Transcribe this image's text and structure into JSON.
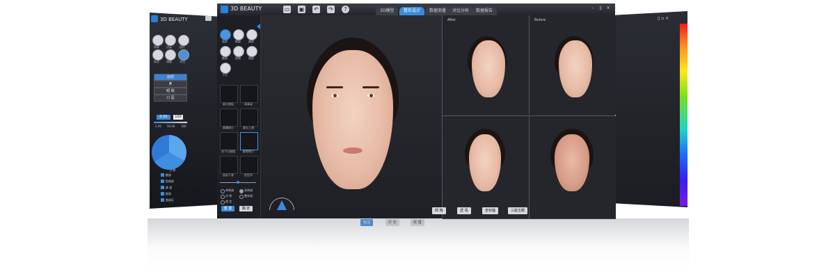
{
  "app": {
    "name": "3D BEAUTY"
  },
  "main": {
    "tabs": [
      {
        "label": "3D模型",
        "active": false
      },
      {
        "label": "整形设计",
        "active": true
      },
      {
        "label": "数据测量",
        "active": false
      },
      {
        "label": "对比分析",
        "active": false
      },
      {
        "label": "数据报告",
        "active": false
      }
    ],
    "window_controls": [
      "–",
      "▯",
      "×"
    ],
    "tool_labels": [
      "面部",
      "眼部",
      "鼻部",
      "额部",
      "脸颊",
      "唇部",
      "下巴"
    ],
    "thumbs": [
      "鼻头翘起",
      "高鼻梁",
      "鼻翼缩小",
      "鼻尖上翘",
      "双下巴抽脂",
      "颧骨缩小",
      "面部下垂",
      "脸型窄"
    ],
    "radio_options": [
      {
        "label": "单侧调",
        "on": false
      },
      {
        "label": "多侧调",
        "on": true
      },
      {
        "label": "对  称",
        "on": false
      },
      {
        "label": "整体调",
        "on": false
      },
      {
        "label": "锁  定",
        "on": false
      }
    ],
    "panel_buttons": [
      "重  置",
      "确  定"
    ],
    "split_labels": {
      "after": "After",
      "before": "Before"
    },
    "view_buttons": [
      {
        "label": "标注",
        "active": true
      },
      {
        "label": "灯 光",
        "active": false
      },
      {
        "label": "纹 理",
        "active": false
      },
      {
        "label": "网 格",
        "active": false
      },
      {
        "label": "透 视",
        "active": false
      },
      {
        "label": "坐标轴",
        "active": false
      },
      {
        "label": "三庭五眼",
        "active": false
      }
    ]
  },
  "left_window": {
    "title": "3D BEAUTY",
    "tool_labels": [
      "线条",
      "点云",
      "面片",
      "标注",
      "测量",
      "对比"
    ],
    "menu": [
      "面部",
      "鼻",
      "眼 睛",
      "口 唇"
    ],
    "range": [
      "0.00",
      "100"
    ],
    "axis": [
      "2.00",
      "50.00",
      "100"
    ],
    "legend_title": "分析",
    "legend": [
      "额部",
      "脸颊部",
      "鼻 部",
      "眼周",
      "唇部区"
    ]
  },
  "colors": {
    "accent": "#3a8bdc",
    "panel": "#1d1f24",
    "window": "#26282e"
  }
}
